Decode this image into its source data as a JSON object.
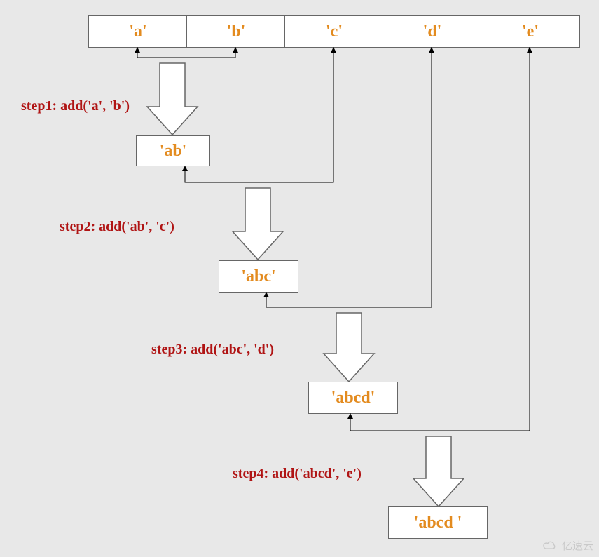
{
  "top_cells": [
    "'a'",
    "'b'",
    "'c'",
    "'d'",
    "'e'"
  ],
  "results": {
    "r1": "'ab'",
    "r2": "'abc'",
    "r3": "'abcd'",
    "r4": "'abcd  '"
  },
  "steps": {
    "s1": "step1: add('a', 'b')",
    "s2": "step2: add('ab', 'c')",
    "s3": "step3: add('abc', 'd')",
    "s4": "step4: add('abcd', 'e')"
  },
  "watermark": "亿速云",
  "colors": {
    "text": "#e38b1f",
    "label": "#b01414",
    "border": "#666",
    "bg": "#e8e8e8"
  }
}
